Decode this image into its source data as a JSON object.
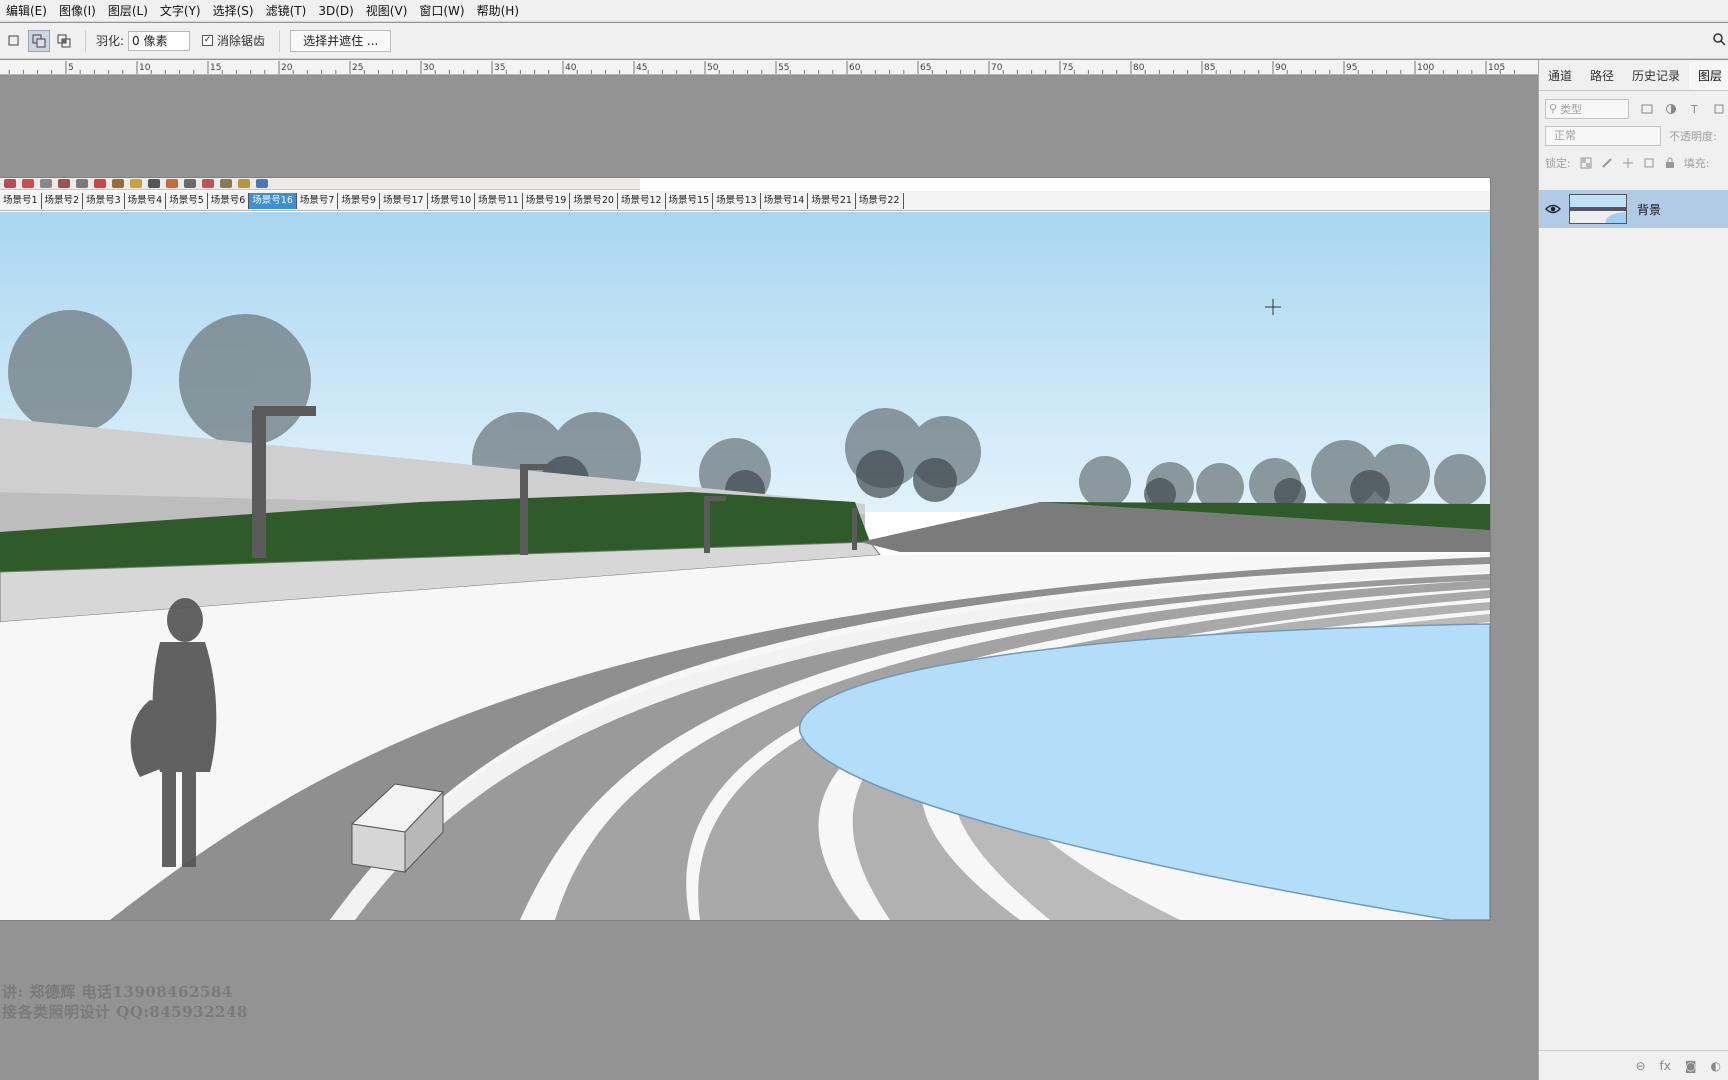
{
  "menubar": {
    "items": [
      "编辑(E)",
      "图像(I)",
      "图层(L)",
      "文字(Y)",
      "选择(S)",
      "滤镜(T)",
      "3D(D)",
      "视图(V)",
      "窗口(W)",
      "帮助(H)"
    ]
  },
  "options": {
    "feather_label": "羽化:",
    "feather_value": "0 像素",
    "antialias_label": "消除锯齿",
    "antialias_checked": true,
    "select_mask_button": "选择并遮住 ..."
  },
  "ruler": {
    "labels": [
      "5",
      "10",
      "15",
      "20",
      "25",
      "30",
      "35",
      "40",
      "45",
      "50",
      "55",
      "60",
      "65",
      "70",
      "75",
      "80",
      "85",
      "90",
      "95",
      "100",
      "105"
    ]
  },
  "sketchup": {
    "scene_tabs": [
      "场景号1",
      "场景号2",
      "场景号3",
      "场景号4",
      "场景号5",
      "场景号6",
      "场景号16",
      "场景号7",
      "场景号9",
      "场景号17",
      "场景号10",
      "场景号11",
      "场景号19",
      "场景号20",
      "场景号12",
      "场景号15",
      "场景号13",
      "场景号14",
      "场景号21",
      "场景号22"
    ],
    "active_scene": "场景号16"
  },
  "watermark": {
    "line1": "讲: 郑德辉  电话13908462584",
    "line2": "接各类照明设计 QQ:845932248"
  },
  "panel": {
    "tabs": [
      "通道",
      "路径",
      "历史记录",
      "图层"
    ],
    "active_tab": "图层",
    "filter_placeholder": "类型",
    "blend_mode": "正常",
    "opacity_label": "不透明度:",
    "lock_label": "锁定:",
    "fill_label": "填充:",
    "layer_name": "背景",
    "bottom_icons": [
      "link-icon",
      "fx-icon",
      "mask-icon",
      "adjustment-icon"
    ],
    "fx_label": "fx"
  },
  "colors": {
    "sky_top": "#a9d6f1",
    "sky_bottom": "#d9eef9",
    "water": "#b3ddf8",
    "grass": "#2f5a2a",
    "active_layer": "#b1cbe6",
    "active_scene_tab": "#3d8fd6"
  }
}
